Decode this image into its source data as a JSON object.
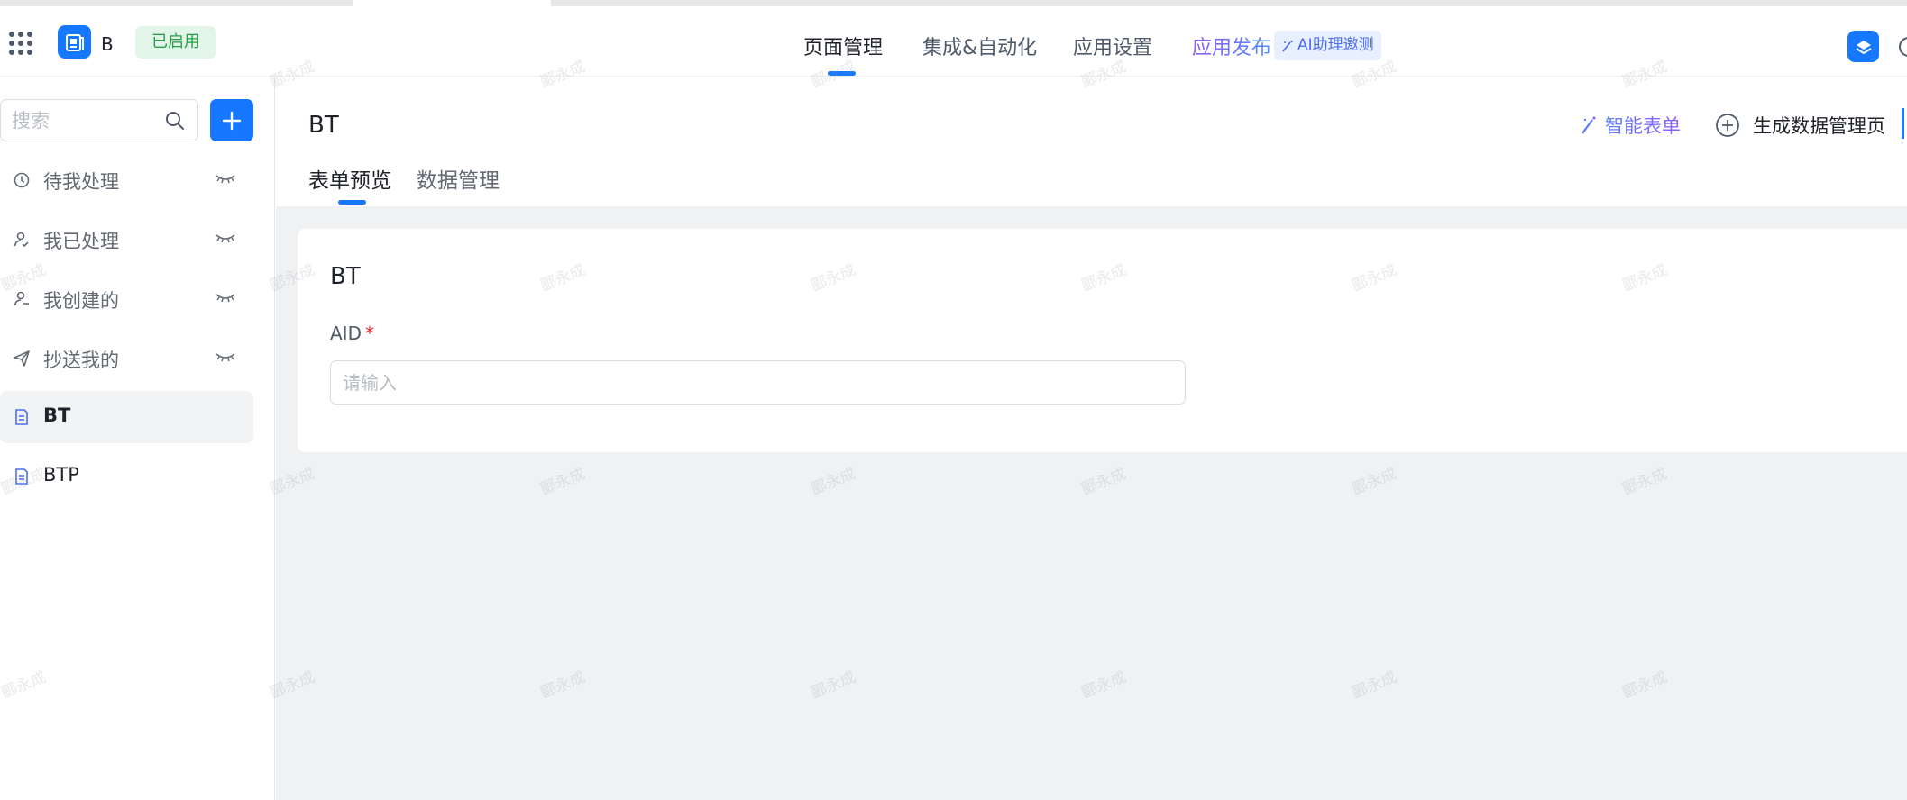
{
  "header": {
    "app_name": "B",
    "status_badge": "已启用",
    "nav": [
      "页面管理",
      "集成&自动化",
      "应用设置",
      "应用发布"
    ],
    "ai_badge": "AI助理邀测"
  },
  "sidebar": {
    "search_placeholder": "搜索",
    "items": [
      {
        "label": "待我处理",
        "icon": "clock-icon"
      },
      {
        "label": "我已处理",
        "icon": "user-check-icon"
      },
      {
        "label": "我创建的",
        "icon": "user-add-icon"
      },
      {
        "label": "抄送我的",
        "icon": "send-icon"
      },
      {
        "label": "BT",
        "icon": "form-icon"
      },
      {
        "label": "BTP",
        "icon": "form-icon"
      }
    ]
  },
  "main": {
    "title": "BT",
    "smart_form": "智能表单",
    "gen_page": "生成数据管理页",
    "tabs": [
      "表单预览",
      "数据管理"
    ]
  },
  "form": {
    "title": "BT",
    "field_label": "AID",
    "required_mark": "*",
    "placeholder": "请输入"
  },
  "watermark_text": "郾永成",
  "colors": {
    "accent": "#1677ff",
    "badge_green": "#23a049",
    "ai_purple": "#8f5cf7"
  }
}
